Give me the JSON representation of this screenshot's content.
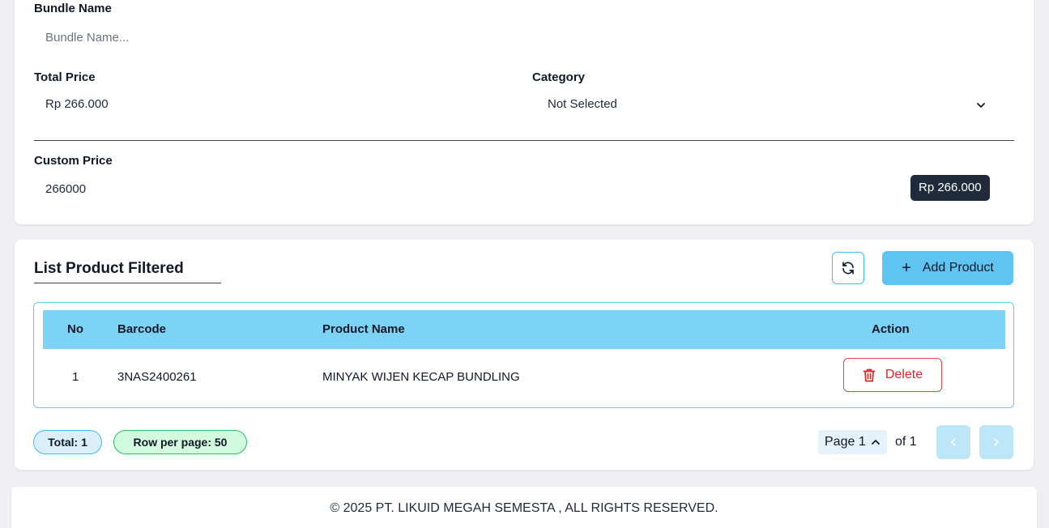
{
  "form": {
    "bundle_name_label": "Bundle Name",
    "bundle_name_placeholder": "Bundle Name...",
    "total_price_label": "Total Price",
    "total_price_value": "Rp 266.000",
    "category_label": "Category",
    "category_value": "Not Selected",
    "custom_price_label": "Custom Price",
    "custom_price_value": "266000",
    "custom_price_badge": "Rp 266.000"
  },
  "list": {
    "title": "List Product Filtered",
    "refresh_icon": "refresh-icon",
    "add_button_label": "Add Product",
    "columns": [
      "No",
      "Barcode",
      "Product Name",
      "Action"
    ],
    "rows": [
      {
        "no": "1",
        "barcode": "3NAS2400261",
        "product_name": "MINYAK WIJEN KECAP BUNDLING",
        "action_label": "Delete"
      }
    ],
    "total_label": "Total: 1",
    "rows_per_page_label": "Row per page: 50",
    "page_label": "Page 1",
    "of_label": "of 1"
  },
  "footer": {
    "copyright": "© 2025 PT. LIKUID MEGAH SEMESTA , ALL RIGHTS RESERVED."
  },
  "colors": {
    "accent": "#5ec4f1",
    "table_header": "#7dd3f5",
    "danger": "#dc2626",
    "badge_dark": "#1f2a3b"
  }
}
